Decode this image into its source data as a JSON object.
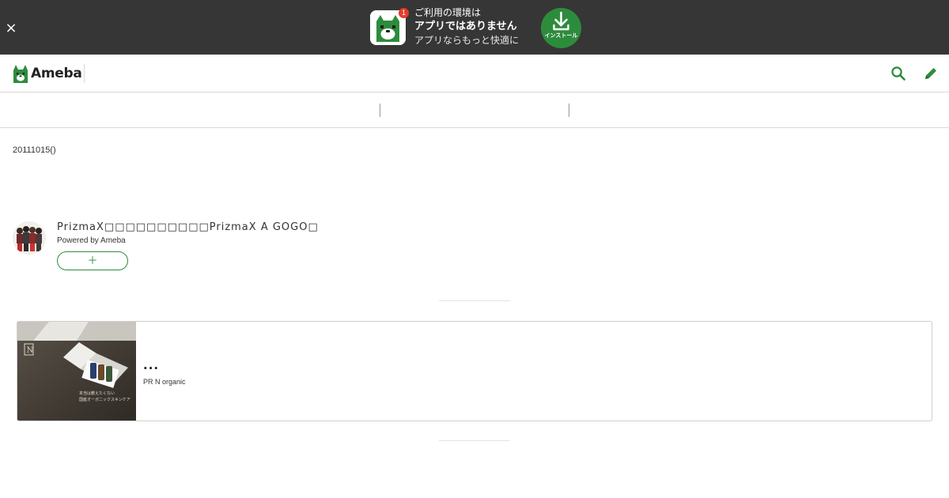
{
  "banner": {
    "close_glyph": "×",
    "badge_count": "1",
    "line1": "ご利用の環境は",
    "line2": "アプリではありません",
    "line3": "アプリならもっと快適に",
    "install_label": "インストール",
    "icons": [
      "close-icon",
      "ameba-app-icon",
      "download-icon"
    ]
  },
  "header": {
    "logo_text": "Ameba",
    "icons": [
      "ameba-logo-icon",
      "search-icon",
      "pencil-icon"
    ]
  },
  "post": {
    "date": "20111015()"
  },
  "profile": {
    "blog_title": "PrizmaX□□□□□□□□□□PrizmaX A GOGO□",
    "powered_by": "Powered by Ameba",
    "follow_label": "＋"
  },
  "ad": {
    "title": "...",
    "sponsor": "PR N organic"
  },
  "colors": {
    "banner_bg": "#363636",
    "brand_green": "#2d8c3c",
    "badge_red": "#e23b2e"
  }
}
